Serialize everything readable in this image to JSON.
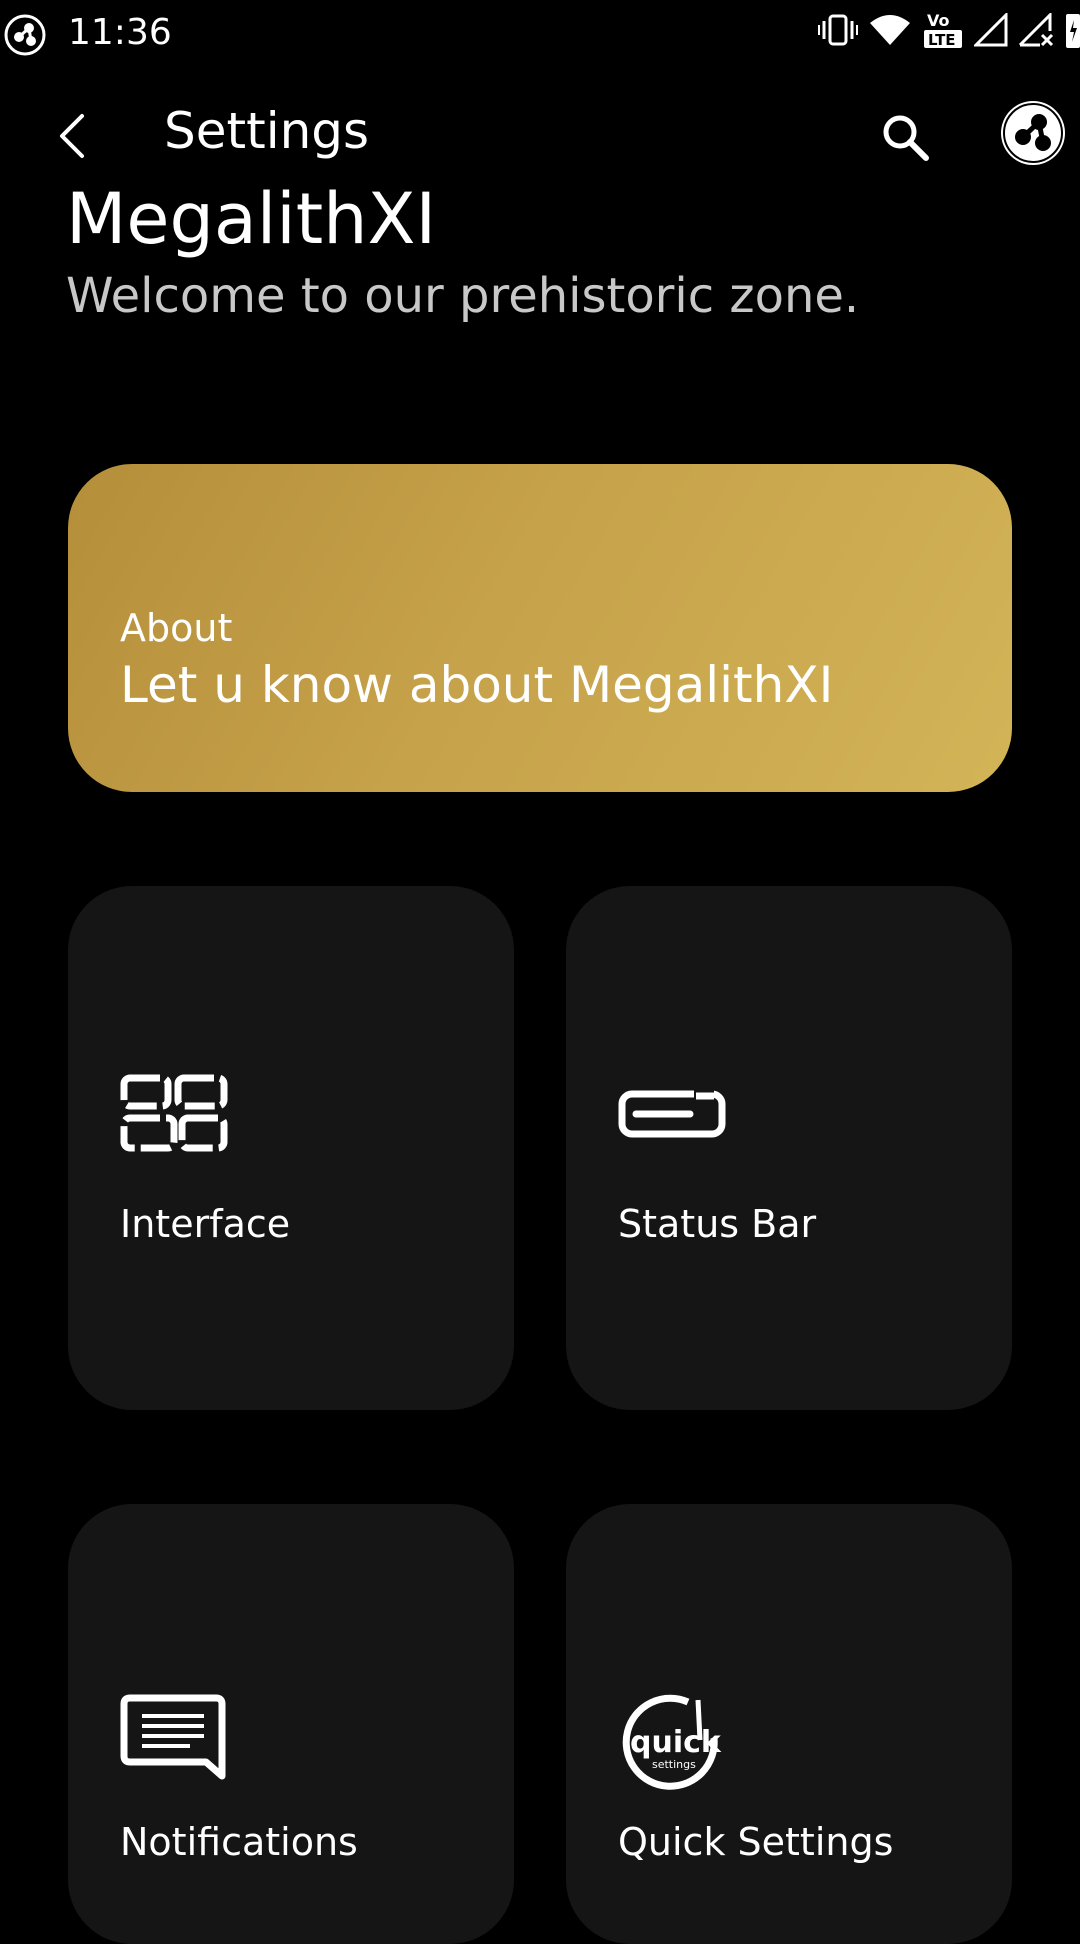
{
  "status_bar": {
    "time": "11:36",
    "left_icon": "megalith-logo-icon",
    "right_icons": [
      "vibrate-icon",
      "wifi-icon",
      "volte-icon",
      "signal-icon",
      "signal-no-data-icon",
      "battery-charging-icon"
    ],
    "volte_label_top": "Vo",
    "volte_label_bottom": "LTE"
  },
  "toolbar": {
    "title": "Settings",
    "back_icon": "back-arrow-icon",
    "search_icon": "search-icon",
    "logo_icon": "megalith-logo-icon"
  },
  "header": {
    "title": "MegalithXI",
    "subtitle": "Welcome to our prehistoric zone."
  },
  "about_card": {
    "label": "About",
    "text": "Let u know about MegalithXI",
    "color_start": "#b58e3a",
    "color_end": "#d3b457"
  },
  "tiles": [
    {
      "label": "Interface",
      "icon": "interface-icon"
    },
    {
      "label": "Status Bar",
      "icon": "status-bar-icon"
    },
    {
      "label": "Notifications",
      "icon": "notifications-icon"
    },
    {
      "label": "Quick Settings",
      "icon": "quick-settings-icon",
      "icon_text": "quick",
      "icon_subtext": "settings"
    }
  ],
  "colors": {
    "background": "#000000",
    "tile": "#151515",
    "subtitle": "#c8c8c8"
  }
}
